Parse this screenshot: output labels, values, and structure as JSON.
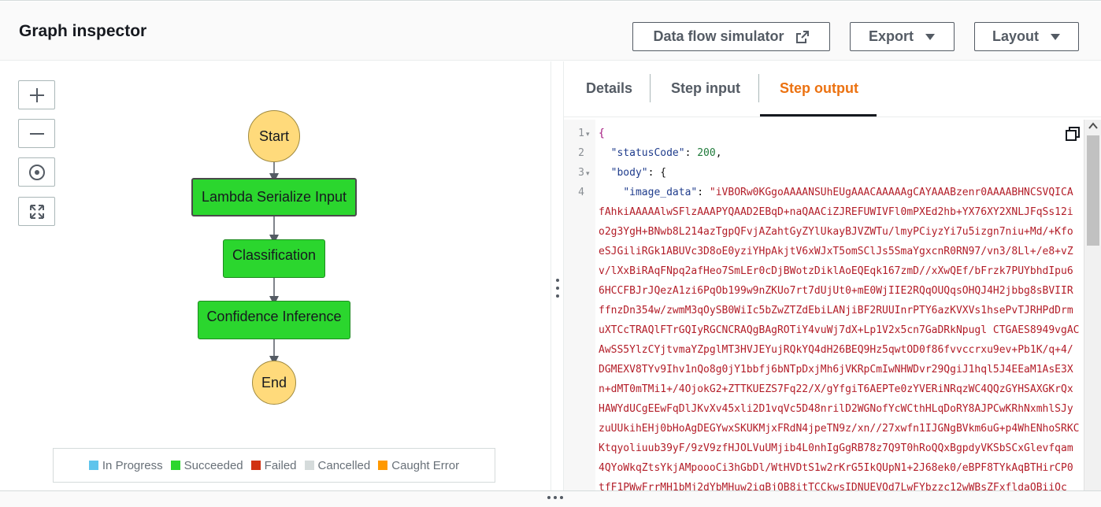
{
  "header": {
    "title": "Graph inspector",
    "buttons": {
      "data_flow": "Data flow simulator",
      "export": "Export",
      "layout": "Layout"
    }
  },
  "graph": {
    "zoom_controls": [
      "zoom-in",
      "zoom-out",
      "center",
      "fit"
    ],
    "nodes": {
      "start": "Start",
      "lambda": "Lambda Serialize Input",
      "classification": "Classification",
      "confidence": "Confidence Inference",
      "end": "End"
    },
    "legend": [
      {
        "label": "In Progress",
        "color": "#5fc4ec"
      },
      {
        "label": "Succeeded",
        "color": "#2bd62e"
      },
      {
        "label": "Failed",
        "color": "#d13212"
      },
      {
        "label": "Cancelled",
        "color": "#d5dbdb"
      },
      {
        "label": "Caught Error",
        "color": "#ff9900"
      }
    ]
  },
  "tabs": {
    "details": "Details",
    "step_input": "Step input",
    "step_output": "Step output",
    "active": "Step output"
  },
  "editor": {
    "line_numbers": [
      "1",
      "2",
      "3",
      "4"
    ],
    "line1": "{",
    "line2_key": "\"statusCode\"",
    "line2_value": "200",
    "line3_key": "\"body\"",
    "line3_brace": "{",
    "line4_key": "\"image_data\"",
    "line4_value": "\"iVBORw0KGgoAAAANSUhEUgAAACAAAAAgCAYAAABzenr0AAAABHNCSVQICA",
    "wrapped": [
      "fAhkiAAAAAlwSFlzAAAPYQAAD2EBqD+naQAACiZJREFUWIVFl0mPXEd2hb+YX76XY2XNLJFqSs12i",
      "o2g3YgH+BNwb8L214azTgpQFvjAZahtGyZYlUkayBJVZWTu/lmyPCiyzYi7u5izgn7niu+Md/+Kfo",
      "eSJGiliRGk1ABUVc3D8oE0yziYHpAkjtV6xWJxT5omSClJs5SmaYgxcnR0RN97/vn3/8Ll+/e8+vZ",
      "v/lXxBiRAqFNpq2afHeo7SmLEr0cDjBWotzDiklAoEQEqk167zmD//xXwQEf/bFrzk7PUYbhdIpu6",
      "6HCCFBJrJQezA1zi6PqOb199w9nZKUo7rt7dUjUt0+mE0WjIIE2RQqOUQqsOHQJ4H2jbbg8sBVIIR",
      "ffnzDn354w/zwmM3qOySB0WiIc5bZwZTZdEbiLANjiBF2RUUInrPTY6azKVXVs1hsePvTJRHPdDrm",
      "uXTCcTRAQlFTrGQIyRGCNCRAQgBAgROTiY4vuWj7dX+Lp1V2x5cn7GaDRkNpugl CTGAES8949vgAC",
      "AwSS5YlzCYjtvmaYZpglMT3HVJEYujRQkYQ4dH26BEQ9Hz5qwtOD0f86fvvccrxu9ev+Pb1K/q+4/",
      "DGMEXV8TYv9Ihv1nQo8g0jY1bbfj6bNTpDxjMh6jVKRpCmIwNHWDvr29QgiJ1hql5J4EEaM1AsE3X",
      "n+dMT0mTMi1+/4OjokG2+ZTTKUEZS7Fq22/X/gYfgiT6AEPTe0zYVERiNRqzWC4QQzGYHSAXGKrQx",
      "HAWYdUCgEEwFqDlJKvXv45xli2D1vqVc5D48nrilD2WGNofYcWCthHLqDoRY8AJPCwKRhNxmhlSJy",
      "zuUUkihEHj0bHoAgDEGYwxSKUKMjxFRdN4jpeTN9z/xn//27xwfn1IJGNgBVkm6uG+p4WhENhoSRKC",
      "Ktqyoliuub39yF/9zV9zfHJOLVuUMjib4L0nhIgGgRB78z7Q9T0hRoQQxBgpdyVKSbSCxGlevfqam",
      "4QYoWkqZtsYkjAMpoooCi3hGbDl/WtHVDtS1w2rKrG5IkQUpN1+2J68ek0/eBPF8TYkAqBTHirCP0",
      "tfF1PWwFrrMH1bMj2dYbMHuw2iqBjQB8itTCCkwsIDNUEVQd7LwFYbzzc12wWBsZFxfldaQBiiQc"
    ]
  }
}
